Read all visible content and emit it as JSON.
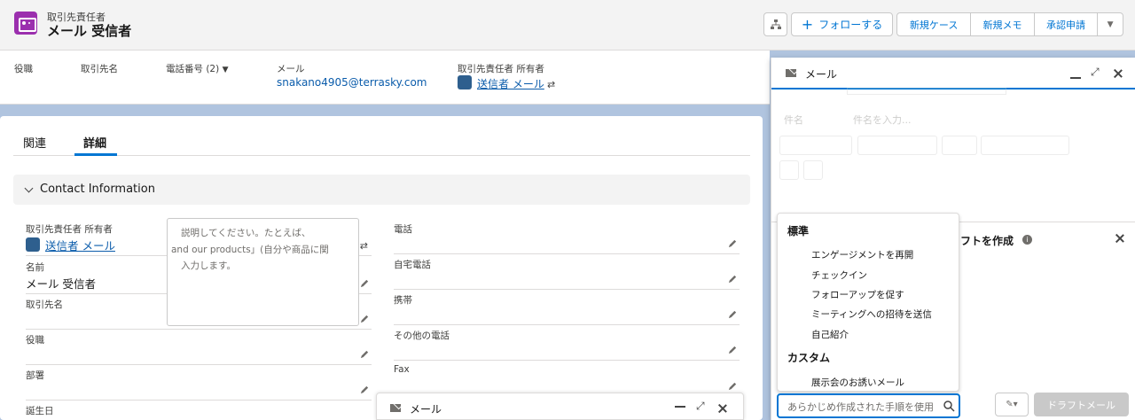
{
  "header": {
    "object_label": "取引先責任者",
    "record_name": "メール 受信者",
    "follow_label": "フォローする",
    "actions": [
      "新規ケース",
      "新規メモ",
      "承認申請"
    ]
  },
  "highlights": [
    {
      "label": "役職",
      "value": ""
    },
    {
      "label": "取引先名",
      "value": ""
    },
    {
      "label": "電話番号 (2)",
      "value": ""
    },
    {
      "label": "メール",
      "value": "snakano4905@terrasky.com"
    },
    {
      "label": "取引先責任者 所有者",
      "value": "送信者 メール"
    }
  ],
  "tabs": [
    "関連",
    "詳細"
  ],
  "section": {
    "title": "Contact Information"
  },
  "left_fields": [
    {
      "label": "取引先責任者 所有者",
      "value": "送信者 メール"
    },
    {
      "label": "名前",
      "value": "メール 受信者"
    },
    {
      "label": "取引先名",
      "value": ""
    },
    {
      "label": "役職",
      "value": ""
    },
    {
      "label": "部署",
      "value": ""
    },
    {
      "label": "誕生日",
      "value": ""
    }
  ],
  "right_fields": [
    {
      "label": "電話",
      "value": ""
    },
    {
      "label": "自宅電話",
      "value": ""
    },
    {
      "label": "携帯",
      "value": ""
    },
    {
      "label": "その他の電話",
      "value": ""
    },
    {
      "label": "Fax",
      "value": ""
    }
  ],
  "mini_dock": {
    "title": "メール"
  },
  "composer": {
    "title": "メール",
    "subject_label": "件名",
    "subject_placeholder": "件名を入力...",
    "draft_title": "フトを作成",
    "draft_text_1": "説明してください。たとえば、",
    "draft_text_2": "and our products」(自分や商品に関",
    "draft_text_3": "入力します。",
    "draft_button": "ドラフトメール"
  },
  "dropdown": {
    "standard_header": "標準",
    "standard_items": [
      "エンゲージメントを再開",
      "チェックイン",
      "フォローアップを促す",
      "ミーティングへの招待を送信",
      "自己紹介"
    ],
    "custom_header": "カスタム",
    "custom_items": [
      "展示会のお誘いメール"
    ],
    "search_placeholder": "あらかじめ作成された手順を使用"
  },
  "colors": {
    "brand": "#0176d3",
    "object_icon": "#9b2fae",
    "link": "#0b5cab"
  }
}
